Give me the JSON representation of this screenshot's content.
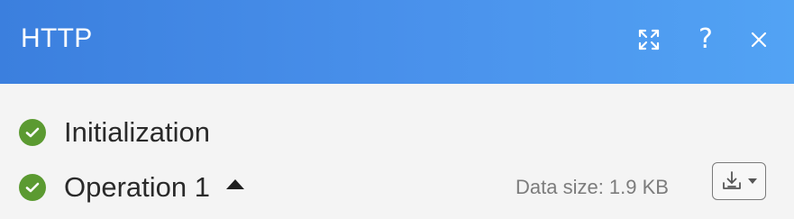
{
  "header": {
    "title": "HTTP",
    "expand_icon": "expand-arrows-icon",
    "help_label": "?",
    "close_icon": "close-icon"
  },
  "operations": [
    {
      "label": "Initialization",
      "status": "success",
      "status_icon": "check-circle-icon"
    },
    {
      "label": "Operation 1",
      "status": "success",
      "status_icon": "check-circle-icon",
      "collapse_icon": "caret-up-icon",
      "data_size": "Data size: 1.9 KB",
      "download_icon": "download-icon",
      "download_dropdown_icon": "chevron-down-icon"
    }
  ],
  "colors": {
    "header_start": "#3b7fde",
    "header_end": "#52a3f4",
    "success": "#5b9a31",
    "background": "#f4f4f4",
    "text": "#2a2a2a",
    "muted_text": "#7c7c7c"
  }
}
